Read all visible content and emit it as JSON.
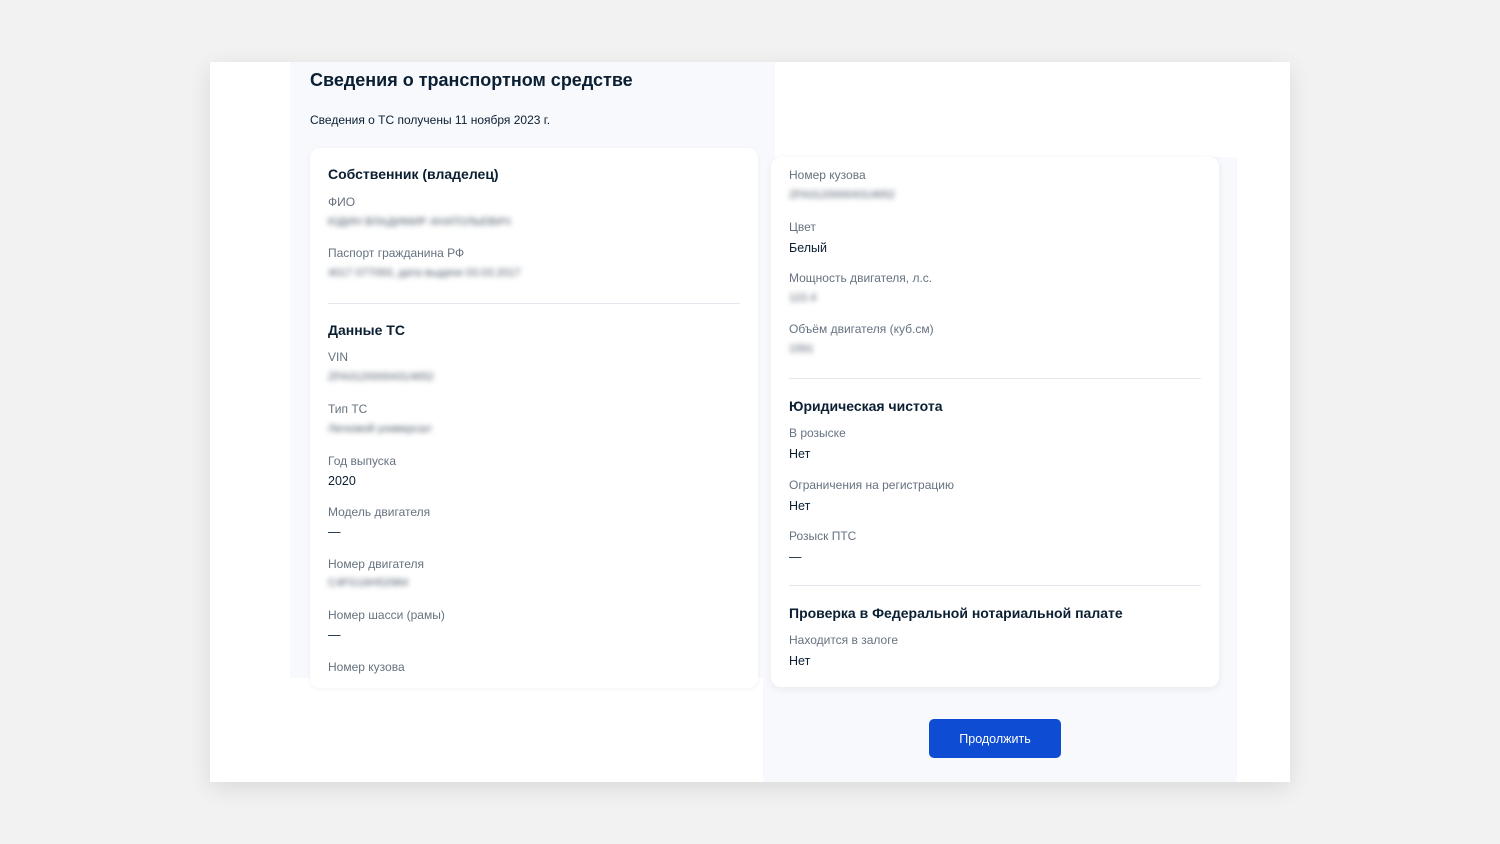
{
  "page": {
    "title": "Сведения о транспортном средстве",
    "subtitle": "Сведения о ТС получены 11 ноября 2023 г."
  },
  "owner": {
    "heading": "Собственник (владелец)",
    "fio_label": "ФИО",
    "fio_value": "ЮДИН ВЛАДИМИР АНАТОЛЬЕВИЧ",
    "passport_label": "Паспорт гражданина РФ",
    "passport_value": "4017 077093, дата выдачи 03.03.2017"
  },
  "vehicle": {
    "heading": "Данные ТС",
    "vin_label": "VIN",
    "vin_value": "ZFA31200004314652",
    "type_label": "Тип ТС",
    "type_value": "Легковой универсал",
    "year_label": "Год выпуска",
    "year_value": "2020",
    "engine_model_label": "Модель двигателя",
    "engine_model_value": "—",
    "engine_number_label": "Номер двигателя",
    "engine_number_value": "C4FG16H52984",
    "chassis_label": "Номер шасси (рамы)",
    "chassis_value": "—",
    "body_label_left": "Номер кузова"
  },
  "vehicle_right": {
    "body_label": "Номер кузова",
    "body_value": "ZFA31200004314652",
    "color_label": "Цвет",
    "color_value": "Белый",
    "power_label": "Мощность двигателя, л.с.",
    "power_value": "122.4",
    "volume_label": "Объём двигателя (куб.см)",
    "volume_value": "1591"
  },
  "legal": {
    "heading": "Юридическая чистота",
    "wanted_label": "В розыске",
    "wanted_value": "Нет",
    "restrictions_label": "Ограничения на регистрацию",
    "restrictions_value": "Нет",
    "pts_label": "Розыск ПТС",
    "pts_value": "—"
  },
  "notary": {
    "heading": "Проверка в Федеральной нотариальной палате",
    "pledge_label": "Находится в залоге",
    "pledge_value": "Нет"
  },
  "actions": {
    "continue_label": "Продолжить"
  },
  "colors": {
    "accent": "#0d4cd3",
    "text": "#0b1f33",
    "muted": "#66727f",
    "panel": "#f7f9fc"
  }
}
